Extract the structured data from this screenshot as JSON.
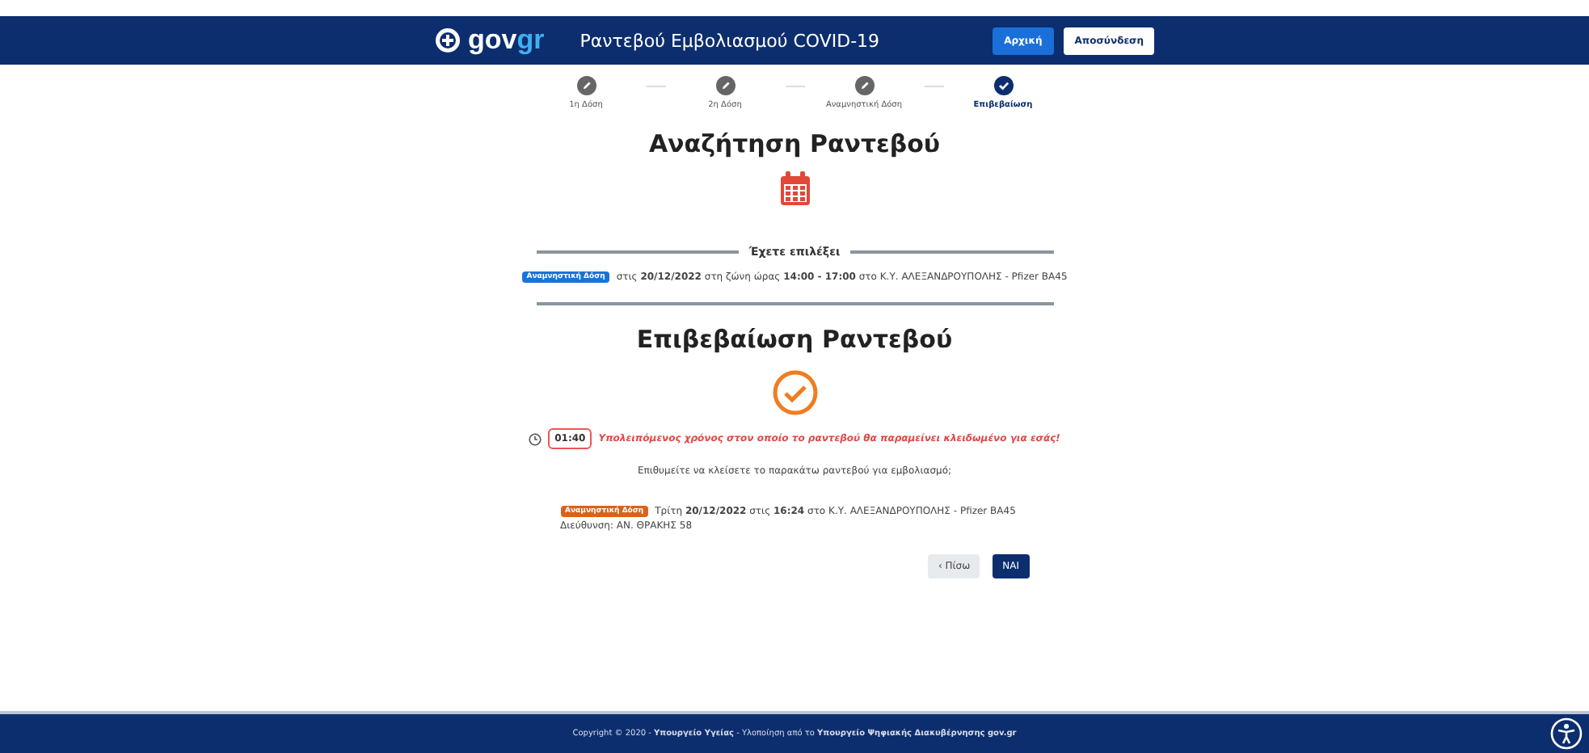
{
  "header": {
    "logo": {
      "part_1": "gov",
      "part_2": "gr"
    },
    "title": "Ραντεβού Εμβολιασμού COVID-19",
    "buttons": [
      {
        "label": "Αρχική",
        "kind": "primary"
      },
      {
        "label": "Αποσύνδεση",
        "kind": "outline"
      }
    ]
  },
  "steps": [
    {
      "label": "1η Δόση",
      "selected": false
    },
    {
      "label": "2η Δόση",
      "selected": false
    },
    {
      "label": "Αναμνηστική Δόση",
      "selected": false
    },
    {
      "label": "Επιβεβαίωση",
      "selected": true
    }
  ],
  "search_title": "Αναζήτηση Ραντεβού",
  "selection": {
    "heading": "Έχετε επιλέξει",
    "badge": "Αναμνηστική Δόση",
    "color": "#1a73d9",
    "text": "στις **20/12/2022** στη ζώνη ώρας **14:00 - 17:00** στο Κ.Υ. ΑΛΕΞΑΝΔΡΟΥΠΟΛΗΣ - Pfizer BA45"
  },
  "confirm_title": "Επιβεβαίωση Ραντεβού",
  "timer": {
    "time": "01:40",
    "message": "Υπολειπόμενος χρόνος στον οποίο το ραντεβού θα παραμείνει κλειδωμένο για εσάς!"
  },
  "question": "Επιθυμείτε να κλείσετε το παρακάτω ραντεβού για εμβολιασμό;",
  "appointment": {
    "badge": "Αναμνηστική Δόση",
    "color": "#d9621a",
    "text": "Τρίτη **20/12/2022** στις **16:24** στο Κ.Υ. ΑΛΕΞΑΝΔΡΟΥΠΟΛΗΣ - Pfizer BA45",
    "address": "Διεύθυνση: ΑΝ. ΘΡΑΚΗΣ 58"
  },
  "actions": [
    {
      "label": "‹ Πίσω",
      "kind": "secondary"
    },
    {
      "label": "ΝΑΙ",
      "kind": "primary"
    }
  ],
  "footer": "Copyright © 2020 - **Υπουργείο Υγείας** - Υλοποίηση από το **Υπουργείο Ψηφιακής Διακυβέρνησης gov.gr**"
}
